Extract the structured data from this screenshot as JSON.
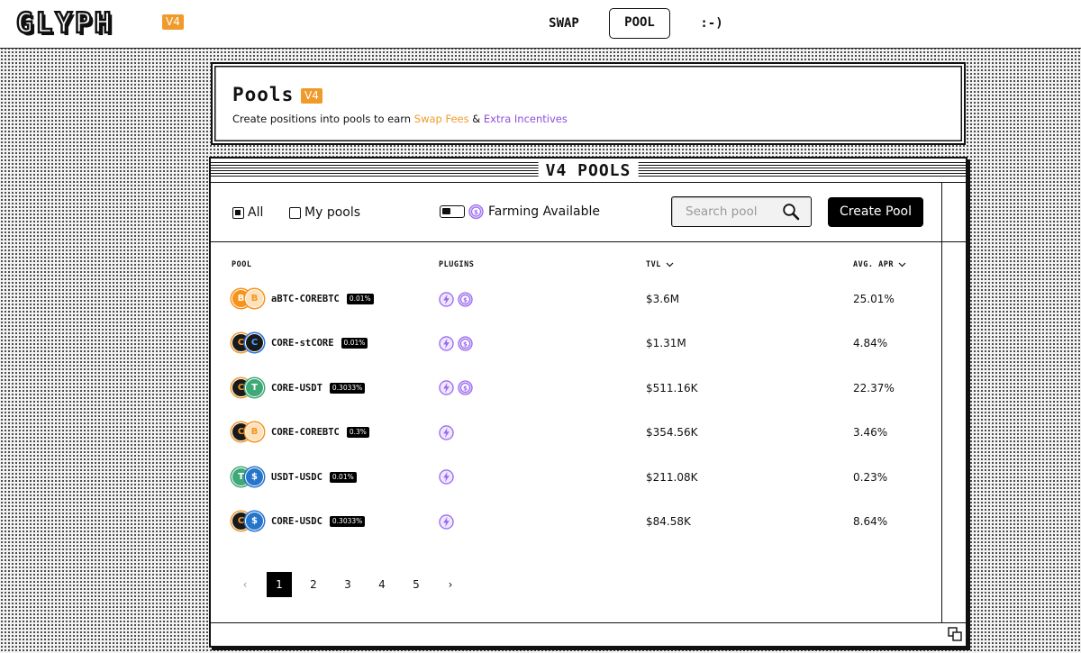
{
  "header": {
    "logo": "GLYPH",
    "version": "V4",
    "nav": {
      "swap": "SWAP",
      "pool": "POOL",
      "smile": ":-)"
    }
  },
  "title_card": {
    "title": "Pools",
    "version": "V4",
    "subtitle_prefix": "Create positions into pools to earn ",
    "swap_fees": "Swap Fees",
    "amp": " & ",
    "extra_incentives": "Extra Incentives"
  },
  "panel": {
    "title": "V4 POOLS",
    "filters": {
      "all": "All",
      "all_checked": true,
      "my_pools": "My pools",
      "my_pools_checked": false,
      "farming": "Farming Available"
    },
    "search": {
      "placeholder": "Search pool"
    },
    "create_button": "Create Pool",
    "columns": {
      "pool": "POOL",
      "plugins": "PLUGINS",
      "tvl": "TVL",
      "apr": "AVG. APR"
    },
    "rows": [
      {
        "pair": "aBTC-COREBTC",
        "fee": "0.01%",
        "tvl": "$3.6M",
        "apr": "25.01%",
        "tokens": [
          "abtc",
          "corebtc"
        ],
        "plugins": [
          "lightning-icon",
          "farming-icon"
        ]
      },
      {
        "pair": "CORE-stCORE",
        "fee": "0.01%",
        "tvl": "$1.31M",
        "apr": "4.84%",
        "tokens": [
          "core",
          "stcore"
        ],
        "plugins": [
          "lightning-icon",
          "farming-icon"
        ]
      },
      {
        "pair": "CORE-USDT",
        "fee": "0.3033%",
        "tvl": "$511.16K",
        "apr": "22.37%",
        "tokens": [
          "core",
          "usdt"
        ],
        "plugins": [
          "lightning-icon",
          "farming-icon"
        ]
      },
      {
        "pair": "CORE-COREBTC",
        "fee": "0.3%",
        "tvl": "$354.56K",
        "apr": "3.46%",
        "tokens": [
          "core",
          "corebtc"
        ],
        "plugins": [
          "lightning-icon"
        ]
      },
      {
        "pair": "USDT-USDC",
        "fee": "0.01%",
        "tvl": "$211.08K",
        "apr": "0.23%",
        "tokens": [
          "usdt",
          "usdc"
        ],
        "plugins": [
          "lightning-icon"
        ]
      },
      {
        "pair": "CORE-USDC",
        "fee": "0.3033%",
        "tvl": "$84.58K",
        "apr": "8.64%",
        "tokens": [
          "core",
          "usdc"
        ],
        "plugins": [
          "lightning-icon"
        ]
      }
    ],
    "pagination": {
      "pages": [
        "1",
        "2",
        "3",
        "4",
        "5"
      ],
      "current": "1",
      "prev": "‹",
      "next": "›"
    }
  },
  "colors": {
    "accent_orange": "#f19a2c",
    "accent_purple": "#8e4ee0",
    "plugin_purple": "#9a6bf0",
    "btc_orange": "#f7931a",
    "usdt_green": "#3fa877",
    "usdc_blue": "#2775ca",
    "core_dark": "#1a1a1a"
  }
}
